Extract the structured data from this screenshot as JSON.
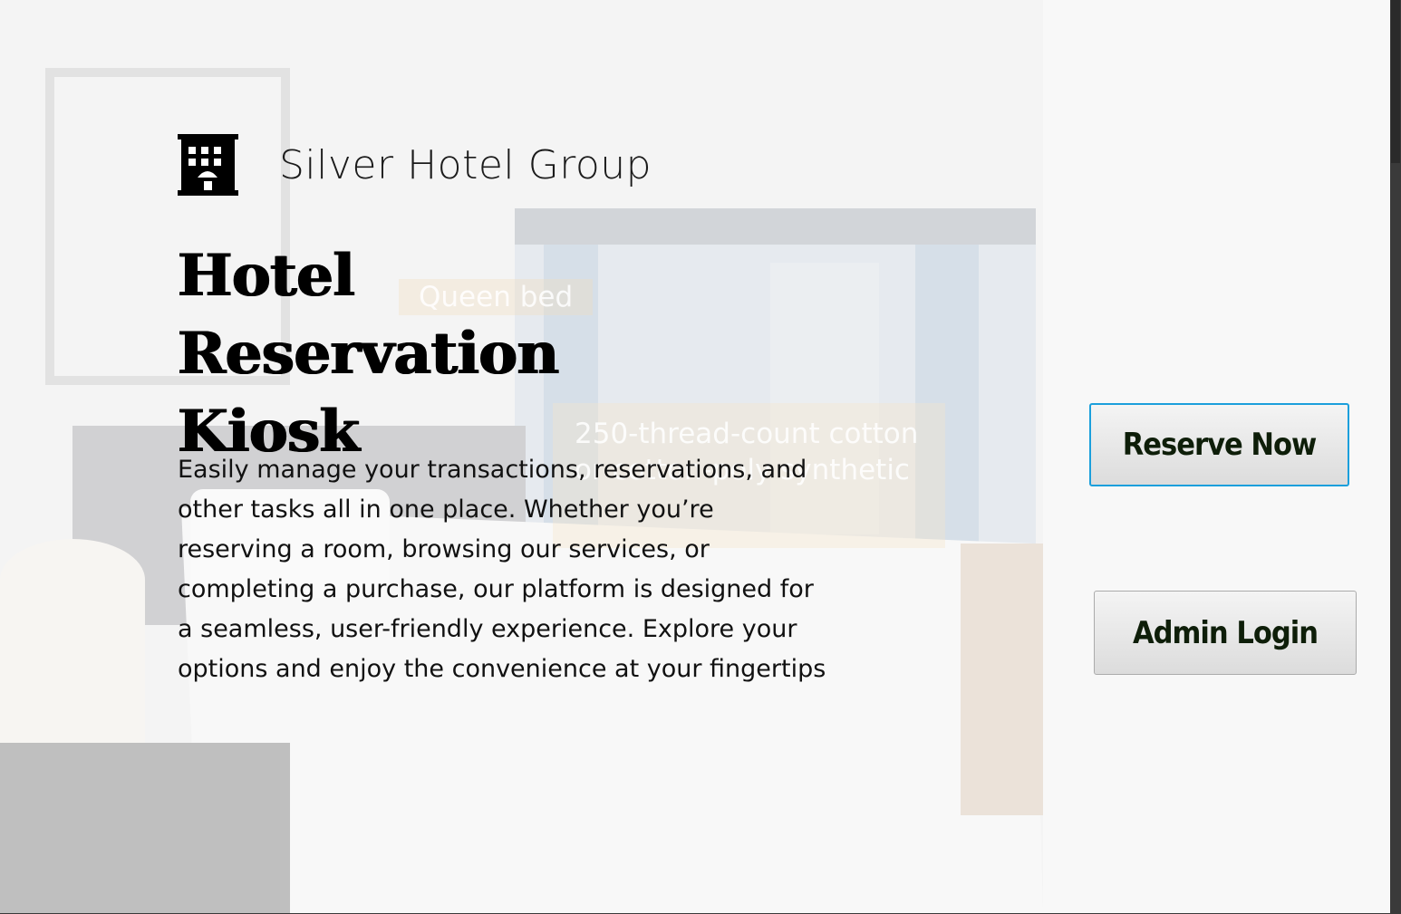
{
  "brand": {
    "logo_icon": "hotel-building-icon",
    "name": "Silver Hotel Group"
  },
  "hero": {
    "headline": "Hotel Reservation Kiosk",
    "description": "Easily manage your transactions, reservations, and other tasks all in one place. Whether you’re reserving a room, browsing our services, or completing a purchase, our platform is designed for a seamless, user-friendly experience. Explore your options and enjoy the convenience at your fingertips",
    "background_captions": {
      "bed": "Queen bed",
      "linens": "250-thread-count cotton or cotton-poly synthetic"
    }
  },
  "actions": {
    "reserve_label": "Reserve Now",
    "admin_label": "Admin Login"
  },
  "colors": {
    "button_text": "#0e1e09",
    "focus_border": "#1b9fdc",
    "panel_bg": "#f8f8f8"
  }
}
